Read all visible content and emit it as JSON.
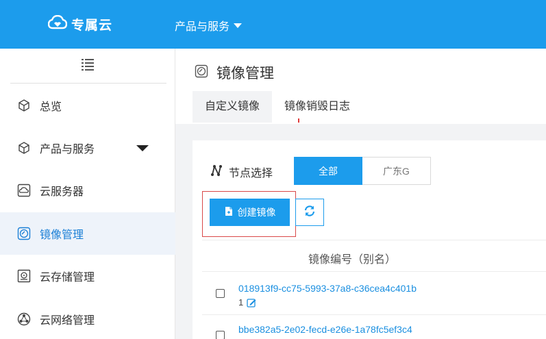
{
  "header": {
    "brand": "专属云",
    "menu_label": "产品与服务"
  },
  "sidebar": {
    "items": [
      {
        "label": "总览",
        "icon": "cube-icon"
      },
      {
        "label": "产品与服务",
        "icon": "cube-icon"
      },
      {
        "label": "云服务器",
        "icon": "server-icon"
      },
      {
        "label": "镜像管理",
        "icon": "disc-icon",
        "active": true
      },
      {
        "label": "云存储管理",
        "icon": "storage-icon"
      },
      {
        "label": "云网络管理",
        "icon": "network-icon"
      }
    ]
  },
  "page": {
    "title": "镜像管理",
    "tabs": [
      {
        "label": "自定义镜像",
        "active": true
      },
      {
        "label": "镜像销毁日志",
        "active": false
      }
    ]
  },
  "filter": {
    "node_label": "节点选择",
    "options": [
      "全部",
      "广东G"
    ],
    "selected": "全部"
  },
  "toolbar": {
    "create_label": "创建镜像"
  },
  "table": {
    "column_header": "镜像编号（别名）",
    "rows": [
      {
        "id": "018913f9-cc75-5993-37a8-c36cea4c401b",
        "alias": "1"
      },
      {
        "id": "bbe382a5-2e02-fecd-e26e-1a78fc5ef3c4",
        "alias": ""
      }
    ]
  },
  "colors": {
    "brand_blue": "#1c9cec",
    "link_blue": "#1a8fe0",
    "highlight_red": "#d94848"
  }
}
